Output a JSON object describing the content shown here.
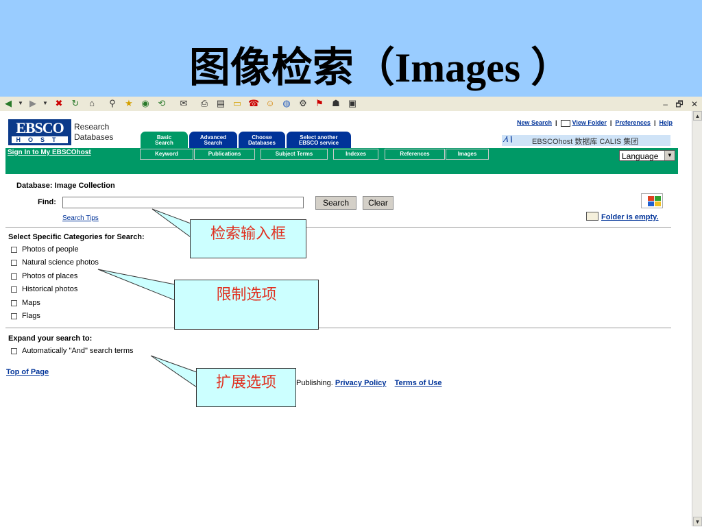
{
  "slide": {
    "title": "图像检索（Images ）"
  },
  "browser": {
    "icons": [
      "back-icon",
      "dropdown-icon",
      "forward-icon",
      "dropdown-icon",
      "stop-icon",
      "refresh-icon",
      "home-icon",
      "search-icon",
      "favorites-icon",
      "media-icon",
      "history-icon",
      "mail-icon",
      "print-icon",
      "edit-icon",
      "discuss-icon",
      "messenger-icon",
      "smiley-icon",
      "world-icon",
      "tool-icon",
      "tool-icon",
      "penguin-icon",
      "book-icon"
    ],
    "window_controls": [
      "–",
      "🗗",
      "✕"
    ]
  },
  "header": {
    "logo_top": "EBSCO",
    "logo_bottom": "HOST",
    "logo_line1": "Research",
    "logo_line2": "Databases",
    "tabs": [
      {
        "line1": "Basic",
        "line2": "Search",
        "active": true
      },
      {
        "line1": "Advanced",
        "line2": "Search",
        "active": false
      },
      {
        "line1": "Choose",
        "line2": "Databases",
        "active": false
      },
      {
        "line1": "Select another",
        "line2": "EBSCO service",
        "active": false
      }
    ],
    "links": {
      "new_search": "New Search",
      "view_folder": "View Folder",
      "preferences": "Preferences",
      "help": "Help",
      "sep": "|"
    },
    "calis": "EBSCOhost 数据库 CALIS 集团"
  },
  "greenbar": {
    "sign_in": "Sign In to My EBSCOhost",
    "subtabs": [
      "Keyword",
      "Publications",
      "Subject Terms",
      "Indexes",
      "References",
      "Images"
    ],
    "language": "Language"
  },
  "search": {
    "database_label": "Database:",
    "database_value": "Image Collection",
    "find_label": "Find:",
    "find_value": "",
    "search_button": "Search",
    "clear_button": "Clear",
    "tips_link": "Search Tips",
    "folder_status": "Folder is empty."
  },
  "categories": {
    "heading": "Select Specific Categories for Search:",
    "items": [
      "Photos of people",
      "Natural science photos",
      "Photos of places",
      "Historical photos",
      "Maps",
      "Flags"
    ]
  },
  "expand": {
    "heading": "Expand your search to:",
    "items": [
      "Automatically \"And\" search terms"
    ]
  },
  "footer": {
    "top_of_page": "Top of Page",
    "publishing": "Publishing.",
    "privacy": "Privacy Policy",
    "terms": "Terms of Use"
  },
  "callouts": {
    "search_box": "检索输入框",
    "limit_options": "限制选项",
    "expand_options": "扩展选项"
  },
  "colors": {
    "title_bg": "#99ccff",
    "green_bar": "#009966",
    "tab_blue": "#003399",
    "callout_bg": "#ccffff",
    "callout_text": "#e03020"
  }
}
